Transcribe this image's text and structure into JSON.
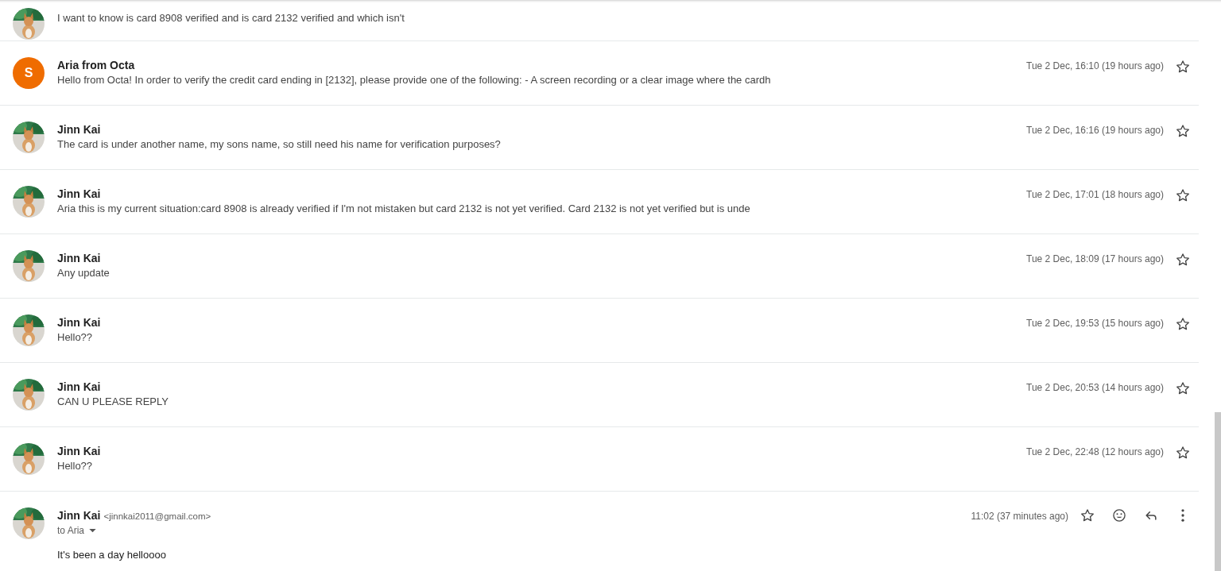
{
  "messages": [
    {
      "kind": "partial",
      "snippet": "I want to know is card 8908 verified and is card 2132 verified and which isn't"
    },
    {
      "kind": "collapsed",
      "letter": "S",
      "sender": "Aria from Octa",
      "snippet": "Hello from Octa! In order to verify the credit card ending in [2132], please provide one of the following: - A screen recording or a clear image where the cardh",
      "time": "Tue 2 Dec, 16:10 (19 hours ago)",
      "starred": false
    },
    {
      "kind": "collapsed",
      "sender": "Jinn Kai",
      "snippet": "The card is under another name, my sons name, so still need his name for verification purposes?",
      "time": "Tue 2 Dec, 16:16 (19 hours ago)",
      "starred": false
    },
    {
      "kind": "collapsed",
      "sender": "Jinn Kai",
      "snippet": "Aria this is my current situation:card 8908 is already verified if I'm not mistaken but card 2132 is not yet verified. Card 2132 is not yet verified but is unde",
      "time": "Tue 2 Dec, 17:01 (18 hours ago)",
      "starred": false
    },
    {
      "kind": "collapsed",
      "sender": "Jinn Kai",
      "snippet": "Any update",
      "time": "Tue 2 Dec, 18:09 (17 hours ago)",
      "starred": false
    },
    {
      "kind": "collapsed",
      "sender": "Jinn Kai",
      "snippet": "Hello??",
      "time": "Tue 2 Dec, 19:53 (15 hours ago)",
      "starred": false
    },
    {
      "kind": "collapsed",
      "sender": "Jinn Kai",
      "snippet": "CAN U PLEASE REPLY",
      "time": "Tue 2 Dec, 20:53 (14 hours ago)",
      "starred": false
    },
    {
      "kind": "collapsed",
      "sender": "Jinn Kai",
      "snippet": "Hello??",
      "time": "Tue 2 Dec, 22:48 (12 hours ago)",
      "starred": false
    },
    {
      "kind": "expanded",
      "sender": "Jinn Kai",
      "email": "<jinnkai2011@gmail.com>",
      "recipient": "to Aria",
      "time": "11:02 (37 minutes ago)",
      "starred": false,
      "body": "It's been a day helloooo"
    }
  ]
}
